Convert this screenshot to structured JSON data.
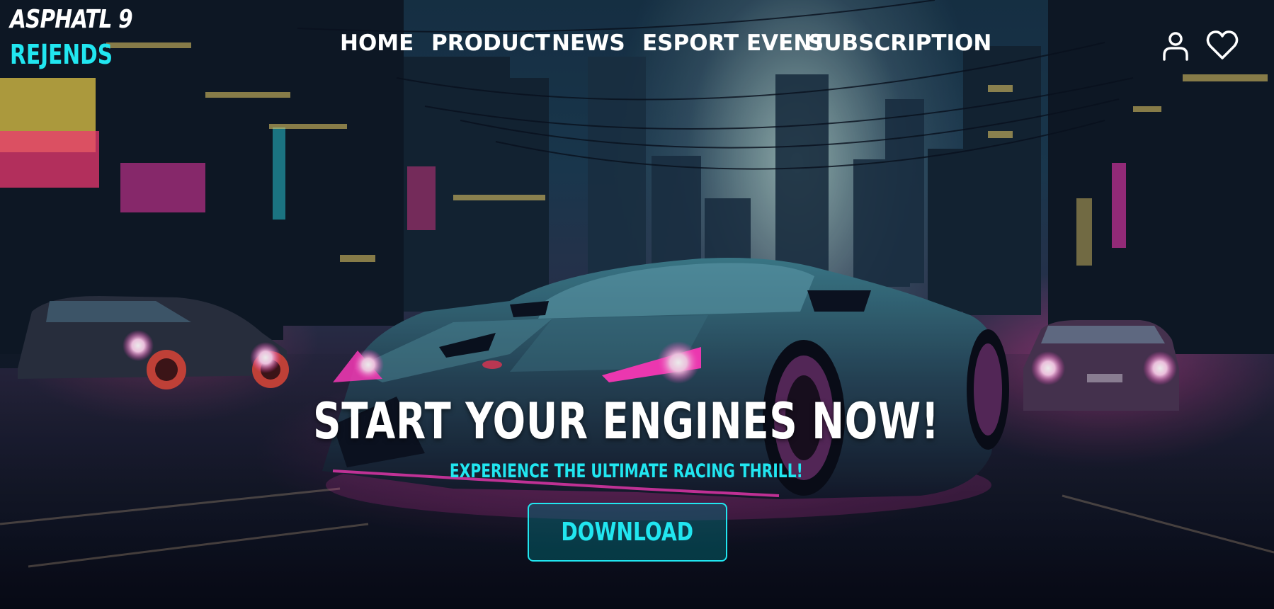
{
  "brand": {
    "line1": "ASPHATL 9",
    "line2": "REJENDS"
  },
  "nav": {
    "items": [
      {
        "label": "HOME"
      },
      {
        "label": "PRODUCT"
      },
      {
        "label": "NEWS"
      },
      {
        "label": "ESPORT EVENT"
      },
      {
        "label": "SUBSCRIPTION"
      }
    ]
  },
  "header_icons": {
    "account": "user-icon",
    "wishlist": "heart-icon"
  },
  "hero": {
    "headline": "START YOUR ENGINES NOW!",
    "subheadline": "EXPERIENCE THE ULTIMATE RACING THRILL!",
    "cta_label": "DOWNLOAD",
    "background": "neon-city-racing-scene"
  },
  "colors": {
    "accent": "#21e6f0",
    "text": "#ffffff",
    "neon_pink": "#ff3cbe"
  }
}
